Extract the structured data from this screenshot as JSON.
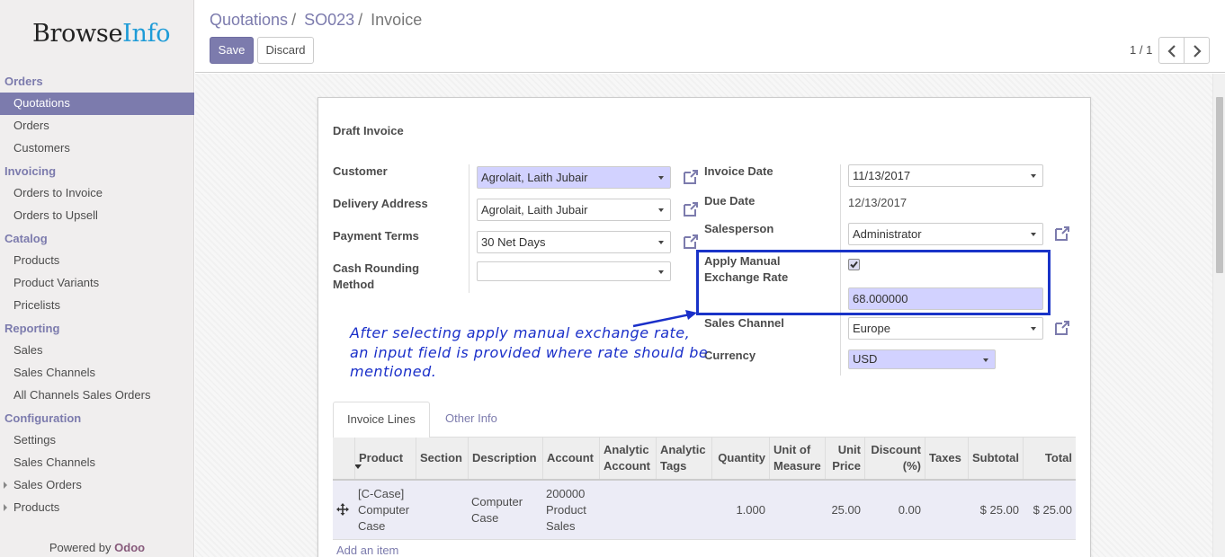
{
  "brand": {
    "name_part1": "Browse",
    "name_part2": "Info"
  },
  "sidebar": {
    "sections": [
      {
        "title": "Orders",
        "items": [
          {
            "label": "Quotations",
            "active": true
          },
          {
            "label": "Orders"
          },
          {
            "label": "Customers"
          }
        ]
      },
      {
        "title": "Invoicing",
        "items": [
          {
            "label": "Orders to Invoice"
          },
          {
            "label": "Orders to Upsell"
          }
        ]
      },
      {
        "title": "Catalog",
        "items": [
          {
            "label": "Products"
          },
          {
            "label": "Product Variants"
          },
          {
            "label": "Pricelists"
          }
        ]
      },
      {
        "title": "Reporting",
        "items": [
          {
            "label": "Sales"
          },
          {
            "label": "Sales Channels"
          },
          {
            "label": "All Channels Sales Orders"
          }
        ]
      },
      {
        "title": "Configuration",
        "items": [
          {
            "label": "Settings"
          },
          {
            "label": "Sales Channels"
          },
          {
            "label": "Sales Orders",
            "expandable": true
          },
          {
            "label": "Products",
            "expandable": true
          }
        ]
      }
    ],
    "powered_by": "Powered by",
    "powered_brand": "Odoo"
  },
  "breadcrumb": {
    "items": [
      "Quotations",
      "SO023",
      "Invoice"
    ],
    "separator": "/"
  },
  "toolbar": {
    "save_label": "Save",
    "discard_label": "Discard"
  },
  "pager": {
    "text": "1 / 1",
    "prev_icon": "chevron-left-icon",
    "next_icon": "chevron-right-icon"
  },
  "form": {
    "title": "Draft Invoice",
    "customer_label": "Customer",
    "customer_value": "Agrolait, Laith Jubair",
    "delivery_label": "Delivery Address",
    "delivery_value": "Agrolait, Laith Jubair",
    "payment_terms_label": "Payment Terms",
    "payment_terms_value": "30 Net Days",
    "cash_rounding_label": "Cash Rounding Method",
    "cash_rounding_value": "",
    "invoice_date_label": "Invoice Date",
    "invoice_date_value": "11/13/2017",
    "due_date_label": "Due Date",
    "due_date_value": "12/13/2017",
    "salesperson_label": "Salesperson",
    "salesperson_value": "Administrator",
    "manual_rate_label": "Apply Manual Exchange Rate",
    "manual_rate_checked": true,
    "manual_rate_value": "68.000000",
    "sales_channel_label": "Sales Channel",
    "sales_channel_value": "Europe",
    "currency_label": "Currency",
    "currency_value": "USD"
  },
  "annotation": {
    "text": "After selecting apply manual exchange rate, an input field is provided where rate should be mentioned.",
    "color": "#1a2fc9"
  },
  "tabs": [
    {
      "label": "Invoice Lines",
      "active": true
    },
    {
      "label": "Other Info"
    }
  ],
  "table": {
    "headers": [
      "Product",
      "Section",
      "Description",
      "Account",
      "Analytic Account",
      "Analytic Tags",
      "Quantity",
      "Unit of Measure",
      "Unit Price",
      "Discount (%)",
      "Taxes",
      "Subtotal",
      "Total"
    ],
    "rows": [
      {
        "product": "[C-Case] Computer Case",
        "section": "",
        "description": "Computer Case",
        "account": "200000 Product Sales",
        "analytic_account": "",
        "analytic_tags": "",
        "quantity": "1.000",
        "uom": "",
        "unit_price": "25.00",
        "discount": "0.00",
        "taxes": "",
        "subtotal": "$ 25.00",
        "total": "$ 25.00"
      }
    ],
    "add_item_label": "Add an item"
  },
  "colors": {
    "accent": "#7c7bad",
    "required_field": "#d2d2ff",
    "annotation_box": "#1933c8"
  }
}
